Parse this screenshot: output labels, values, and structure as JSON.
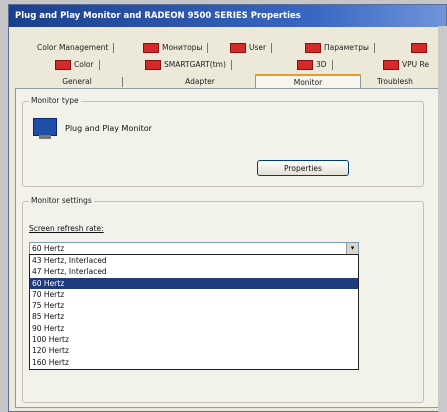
{
  "window": {
    "title": "Plug and Play Monitor and RADEON 9500 SERIES Properties"
  },
  "tabs_row1": [
    {
      "label": "Color Management",
      "icon": ""
    },
    {
      "label": "Мониторы",
      "icon": "flag-icon"
    },
    {
      "label": "User",
      "icon": "flag-icon"
    },
    {
      "label": "Параметры",
      "icon": "flag-icon"
    },
    {
      "label": "",
      "icon": "flag-icon"
    }
  ],
  "tabs_row2": [
    {
      "label": "Color",
      "icon": "flag-icon"
    },
    {
      "label": "SMARTGART(tm)",
      "icon": "flag-icon"
    },
    {
      "label": "3D",
      "icon": "flag-icon"
    },
    {
      "label": "VPU Re",
      "icon": "flag-icon"
    }
  ],
  "tabs_row3": [
    {
      "label": "General"
    },
    {
      "label": "Adapter"
    },
    {
      "label": "Monitor"
    },
    {
      "label": "Troublesh"
    }
  ],
  "monitor_type": {
    "group_label": "Monitor type",
    "name": "Plug and Play Monitor",
    "properties_button": "Properties"
  },
  "monitor_settings": {
    "group_label": "Monitor settings",
    "refresh_label": "Screen refresh rate:",
    "selected": "60 Hertz",
    "options": [
      "43 Hertz, Interlaced",
      "47 Hertz, Interlaced",
      "60 Hertz",
      "70 Hertz",
      "75 Hertz",
      "85 Hertz",
      "90 Hertz",
      "100 Hertz",
      "120 Hertz",
      "160 Hertz"
    ],
    "highlighted_index": 2
  },
  "colors": {
    "title_bar": "#1b3f8c",
    "selection": "#1f3b7e",
    "active_tab_accent": "#e69b28"
  }
}
